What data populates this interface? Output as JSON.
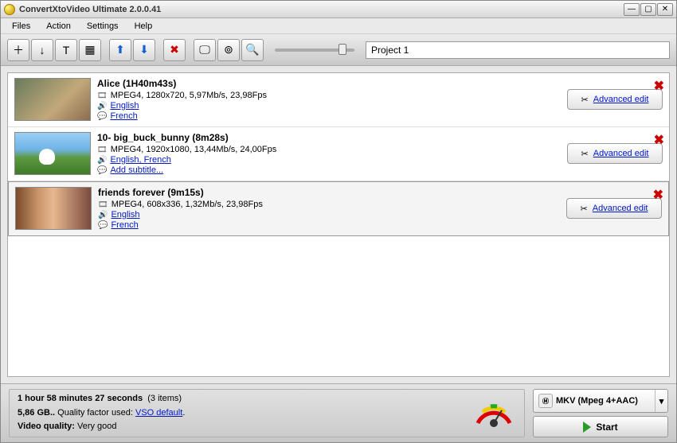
{
  "titlebar": {
    "title": "ConvertXtoVideo Ultimate 2.0.0.41"
  },
  "menu": {
    "items": [
      "Files",
      "Action",
      "Settings",
      "Help"
    ]
  },
  "toolbar": {
    "buttons": [
      {
        "name": "add-file-button",
        "glyph": "＋"
      },
      {
        "name": "add-folder-button",
        "glyph": "↓"
      },
      {
        "name": "subtitle-button",
        "glyph": "T"
      },
      {
        "name": "chapter-button",
        "glyph": "▦"
      },
      {
        "name": "move-up-button",
        "glyph": "⬆"
      },
      {
        "name": "move-down-button",
        "glyph": "⬇"
      },
      {
        "name": "remove-button",
        "glyph": "✖"
      },
      {
        "name": "merge-button",
        "glyph": "🖵"
      },
      {
        "name": "burn-button",
        "glyph": "⊚"
      },
      {
        "name": "preview-button",
        "glyph": "🔍"
      }
    ],
    "project_value": "Project 1"
  },
  "items": [
    {
      "title": "Alice (1H40m43s)",
      "video_info": "MPEG4, 1280x720, 5,97Mb/s, 23,98Fps",
      "audio_label": "English",
      "sub_label": "French",
      "adv_label": "Advanced edit",
      "thumb_class": "a"
    },
    {
      "title": "10- big_buck_bunny (8m28s)",
      "video_info": "MPEG4, 1920x1080, 13,44Mb/s, 24,00Fps",
      "audio_label": "English, French",
      "sub_label": "Add subtitle...",
      "adv_label": "Advanced edit",
      "thumb_class": "b"
    },
    {
      "title": "friends forever (9m15s)",
      "video_info": "MPEG4, 608x336, 1,32Mb/s, 23,98Fps",
      "audio_label": "English",
      "sub_label": "French",
      "adv_label": "Advanced edit",
      "thumb_class": "c",
      "selected": true
    }
  ],
  "summary": {
    "duration": "1 hour 58 minutes 27 seconds",
    "count": "(3 items)",
    "size": "5,86 GB..",
    "qf_label": "Quality factor used:",
    "qf_value": "VSO default",
    "quality_label": "Video quality:",
    "quality_value": "Very good"
  },
  "output": {
    "format": "MKV (Mpeg 4+AAC)",
    "start_label": "Start"
  }
}
